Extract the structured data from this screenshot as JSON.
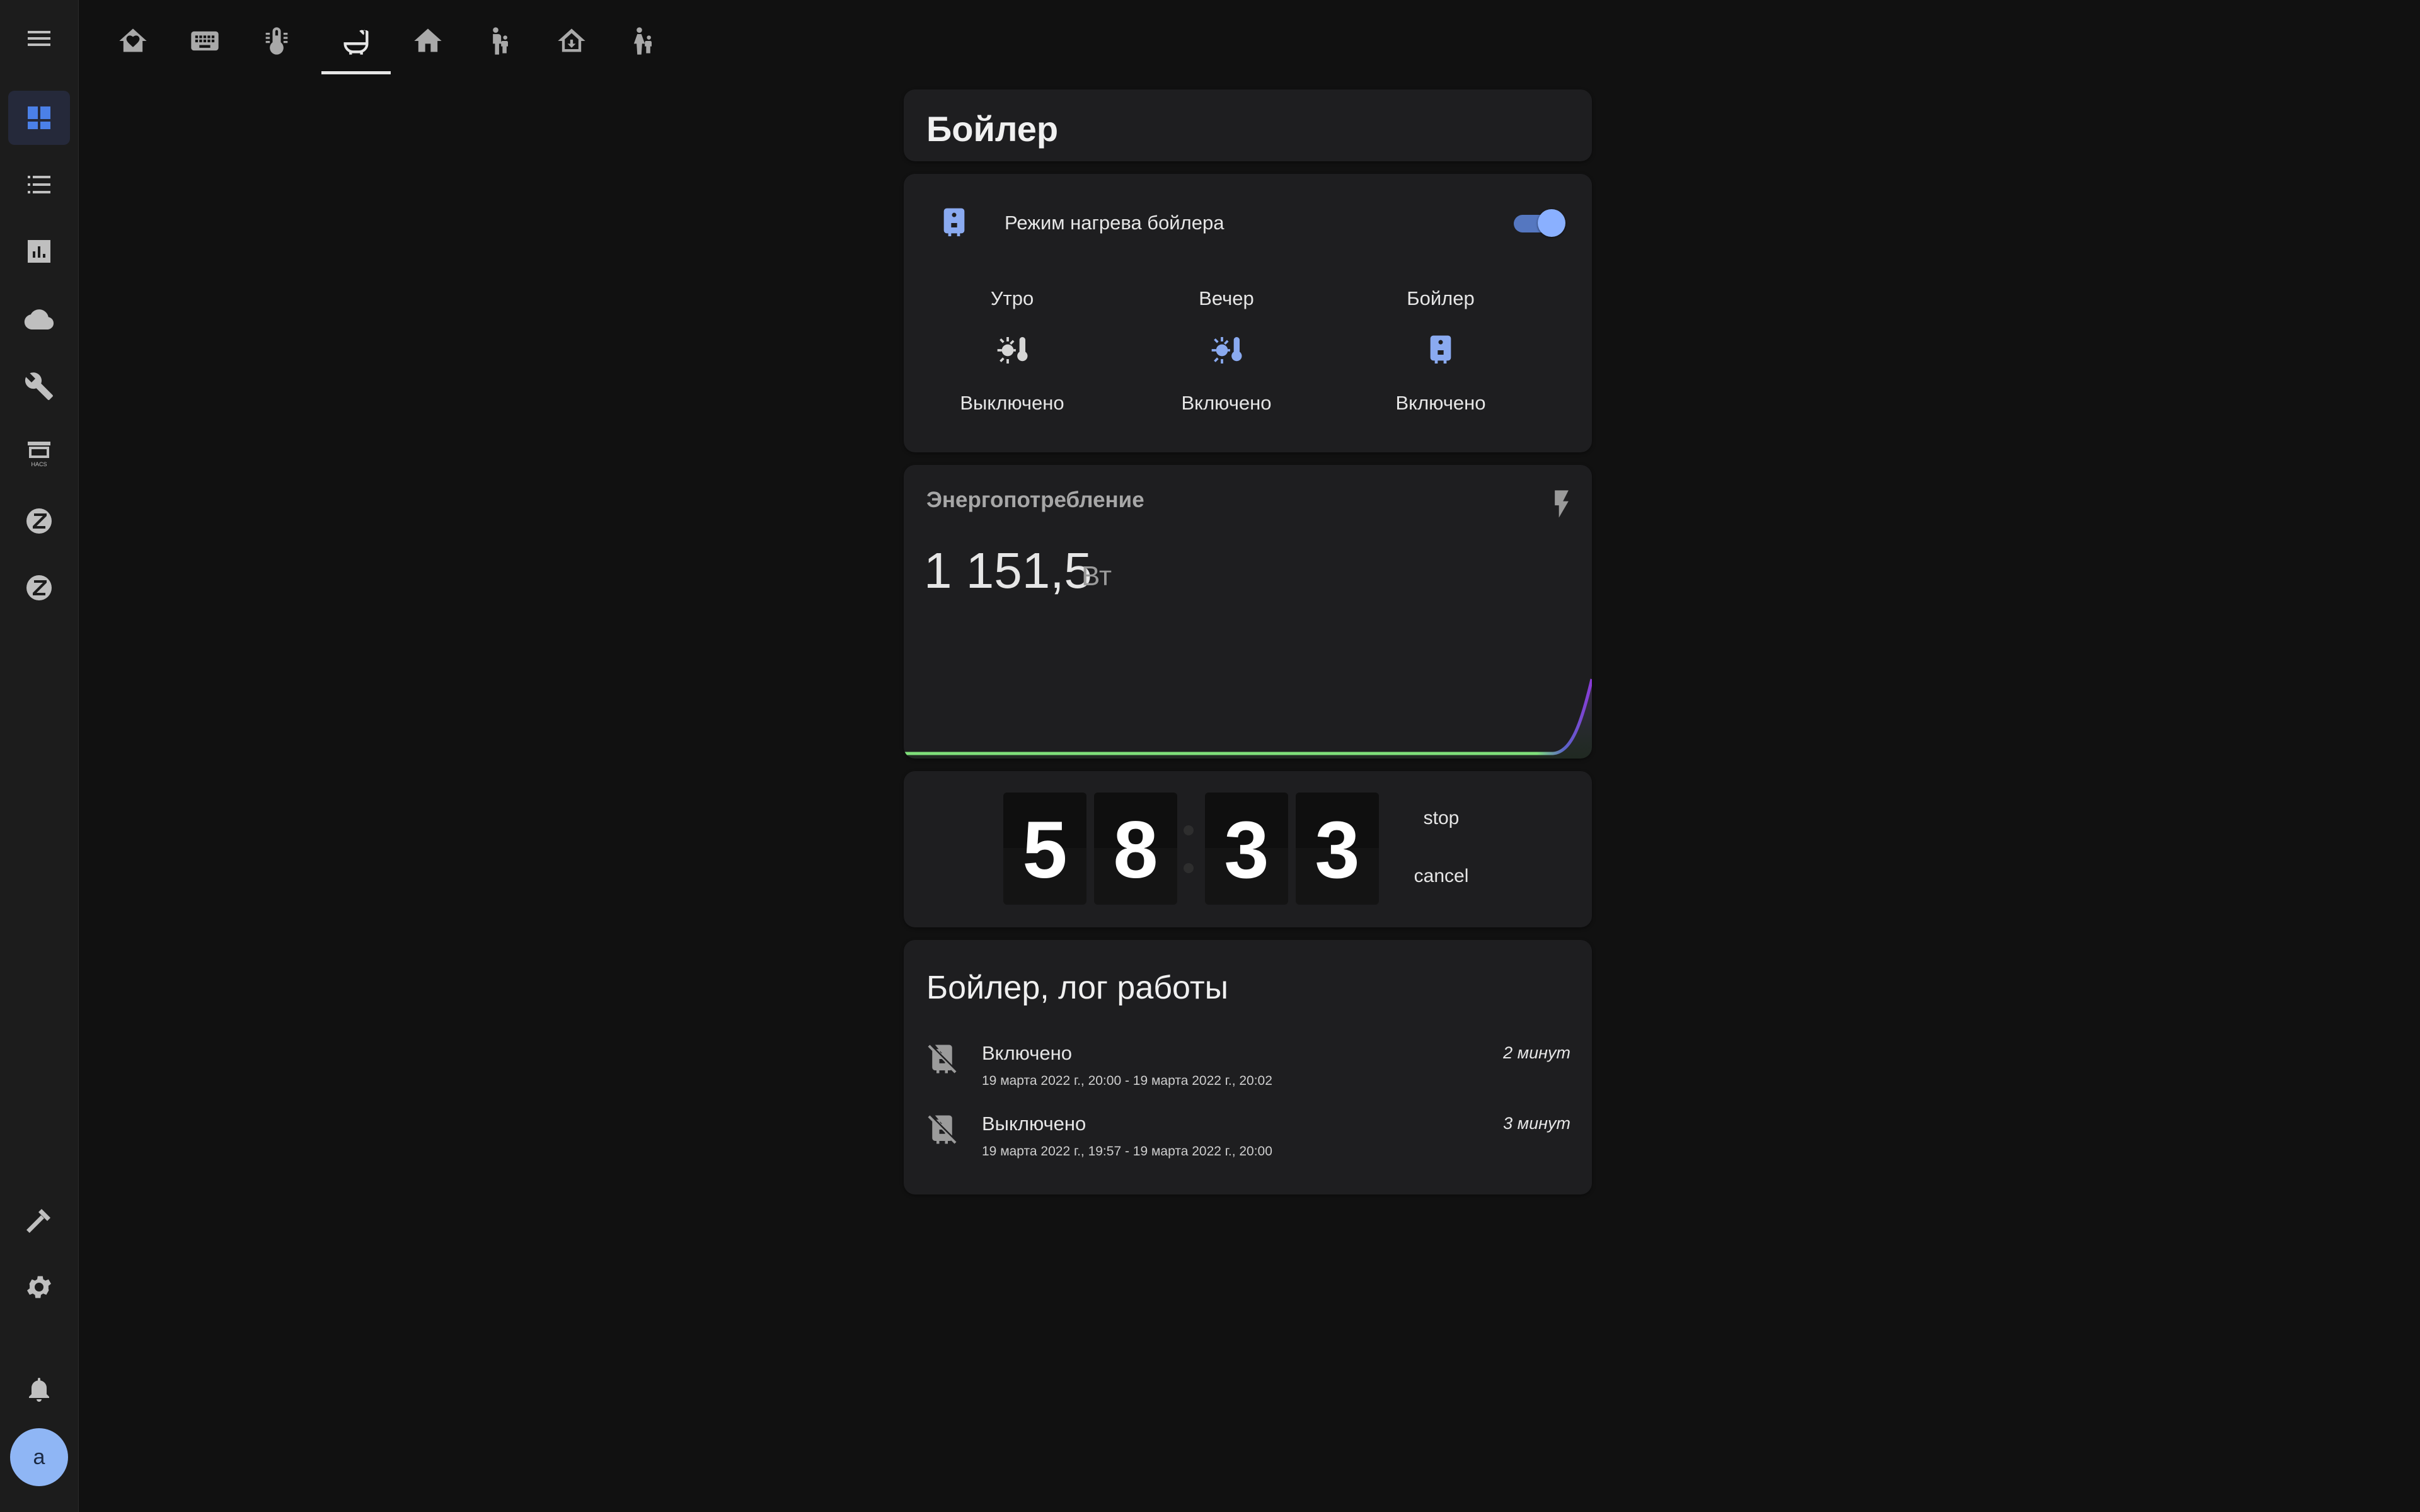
{
  "sidebar": {
    "items": [
      {
        "name": "menu-icon"
      },
      {
        "name": "dashboard-icon"
      },
      {
        "name": "logbook-icon"
      },
      {
        "name": "history-icon"
      },
      {
        "name": "cloud-icon"
      },
      {
        "name": "wrench-icon"
      },
      {
        "name": "hacs-icon",
        "label": "HACS"
      },
      {
        "name": "zwave-icon"
      },
      {
        "name": "zwave-icon"
      },
      {
        "name": "hammer-icon"
      },
      {
        "name": "gear-icon"
      },
      {
        "name": "bell-icon"
      }
    ],
    "avatar_letter": "a"
  },
  "tabs": [
    {
      "icon": "home-heart-icon"
    },
    {
      "icon": "keyboard-icon"
    },
    {
      "icon": "thermometer-icon"
    },
    {
      "icon": "bathtub-icon",
      "active": true
    },
    {
      "icon": "home-import-icon"
    },
    {
      "icon": "human-male-child-icon"
    },
    {
      "icon": "home-export-icon"
    },
    {
      "icon": "human-female-child-icon"
    }
  ],
  "title_card": {
    "title": "Бойлер"
  },
  "entities_card": {
    "row_label": "Режим нагрева бойлера",
    "toggle_on": true,
    "glance": [
      {
        "name": "Утро",
        "icon": "sun-thermometer-icon",
        "state": "Выключено"
      },
      {
        "name": "Вечер",
        "icon": "sun-thermometer-icon",
        "state": "Включено"
      },
      {
        "name": "Бойлер",
        "icon": "water-boiler-icon",
        "state": "Включено"
      }
    ]
  },
  "sensor_card": {
    "name": "Энергопотребление",
    "icon": "flash-icon",
    "value": "1 151,5",
    "unit": "Вт"
  },
  "timer_card": {
    "digits": [
      "5",
      "8",
      "3",
      "3"
    ],
    "stop_label": "stop",
    "cancel_label": "cancel"
  },
  "log_card": {
    "title": "Бойлер, лог работы",
    "entries": [
      {
        "state": "Включено",
        "time": "19 марта 2022 г., 20:00 - 19 марта 2022 г., 20:02",
        "duration": "2 минут"
      },
      {
        "state": "Выключено",
        "time": "19 марта 2022 г., 19:57 - 19 марта 2022 г., 20:00",
        "duration": "3 минут"
      }
    ]
  },
  "colors": {
    "accent": "#4b80e8",
    "active_icon": "#8aaaf0",
    "background": "#111111",
    "card": "#1e1e20"
  }
}
